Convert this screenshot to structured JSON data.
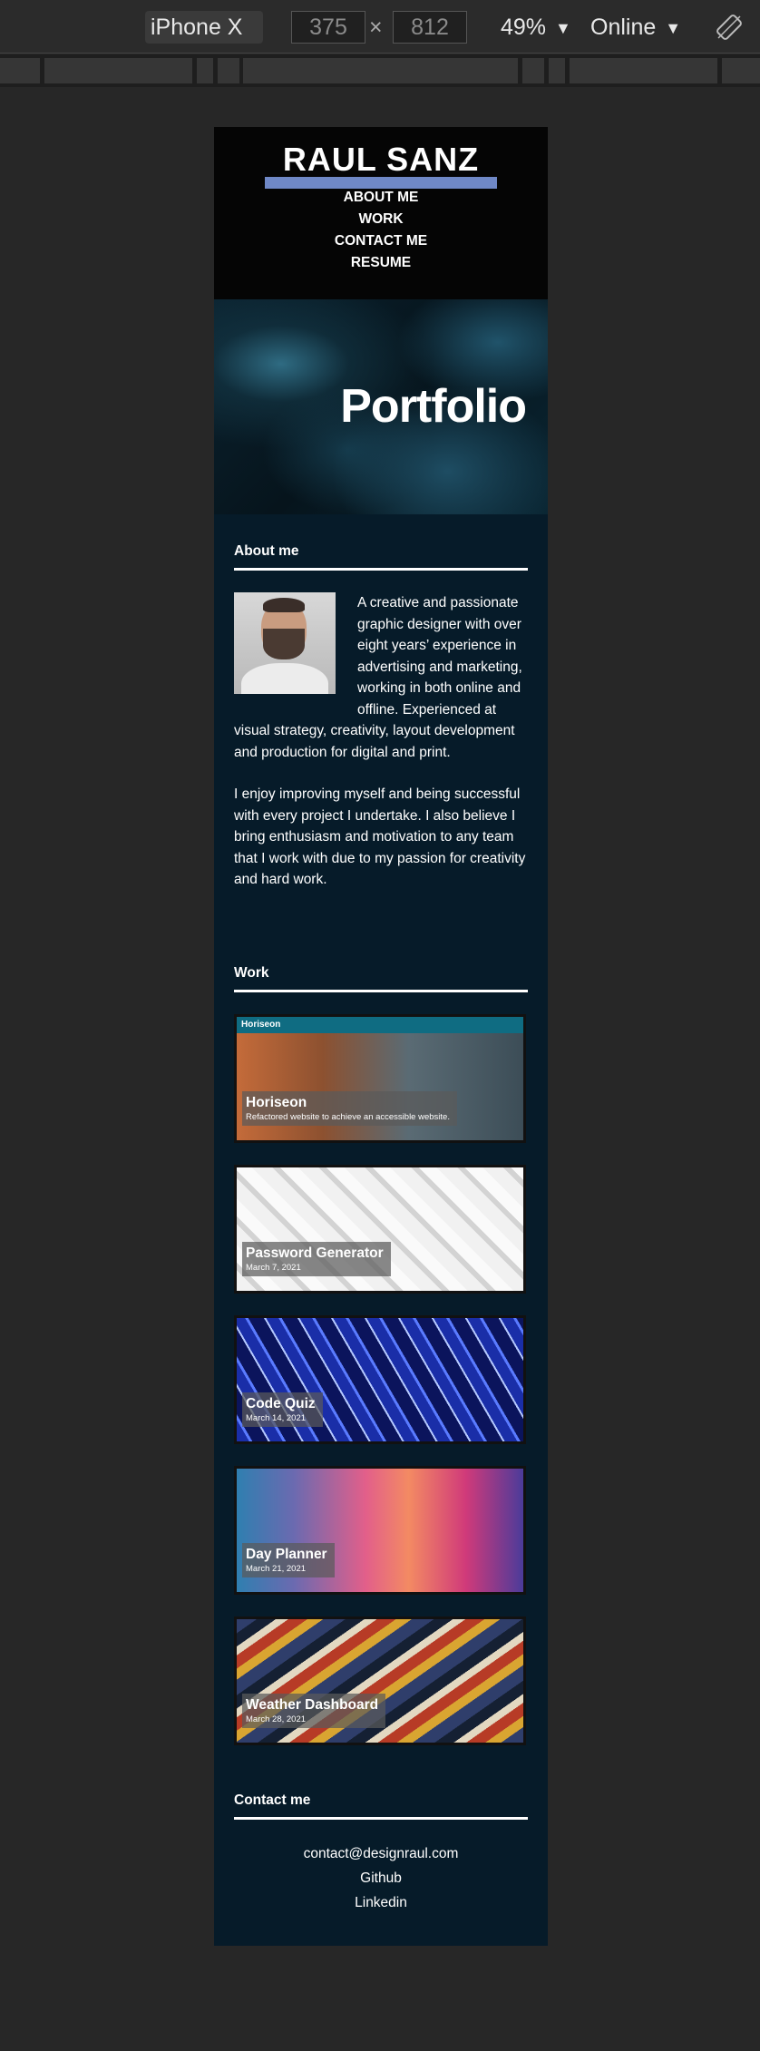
{
  "devtools": {
    "device": "iPhone X",
    "width": "375",
    "times": "×",
    "height": "812",
    "zoom": "49%",
    "network": "Online"
  },
  "site": {
    "logo": "RAUL SANZ",
    "nav": [
      "ABOUT ME",
      "WORK",
      "CONTACT ME",
      "RESUME"
    ],
    "hero_title": "Portfolio",
    "about": {
      "heading": "About me",
      "p1": "A creative and passionate graphic designer with over eight years’ experience in advertising and marketing, working in both online and offline. Experienced at visual strategy, creativity, layout development and production for digital and print.",
      "p2": "I enjoy improving myself and being successful with every project I undertake. I also believe I bring enthusiasm and motivation to any team that I work with due to my passion for creativity and hard work."
    },
    "work": {
      "heading": "Work",
      "cards": [
        {
          "title": "Horiseon",
          "sub": "Refactored website to achieve an accessible website.",
          "brand": "Horiseon"
        },
        {
          "title": "Password Generator",
          "sub": "March 7, 2021"
        },
        {
          "title": "Code Quiz",
          "sub": "March 14, 2021"
        },
        {
          "title": "Day Planner",
          "sub": "March 21, 2021"
        },
        {
          "title": "Weather Dashboard",
          "sub": "March 28, 2021"
        }
      ]
    },
    "contact": {
      "heading": "Contact me",
      "links": [
        "contact@designraul.com",
        "Github",
        "Linkedin"
      ]
    }
  }
}
